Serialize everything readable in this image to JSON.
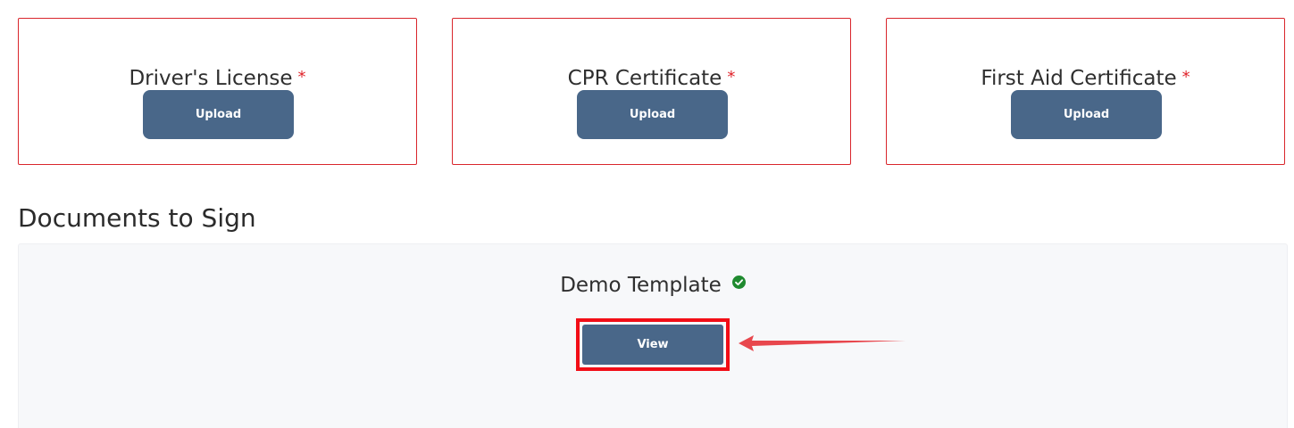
{
  "uploads": [
    {
      "label": "Driver's License",
      "required_mark": "*",
      "button": "Upload"
    },
    {
      "label": "CPR Certificate",
      "required_mark": "*",
      "button": "Upload"
    },
    {
      "label": "First Aid Certificate",
      "required_mark": "*",
      "button": "Upload"
    }
  ],
  "documents_section": {
    "title": "Documents to Sign",
    "document_name": "Demo Template",
    "status_icon": "check-circle-icon",
    "view_button": "View"
  },
  "colors": {
    "card_border": "#d9262c",
    "button_bg": "#496789",
    "required": "#e0242b",
    "status_ok": "#1f8a2f",
    "highlight": "#f20d16",
    "arrow": "#e8474d"
  }
}
